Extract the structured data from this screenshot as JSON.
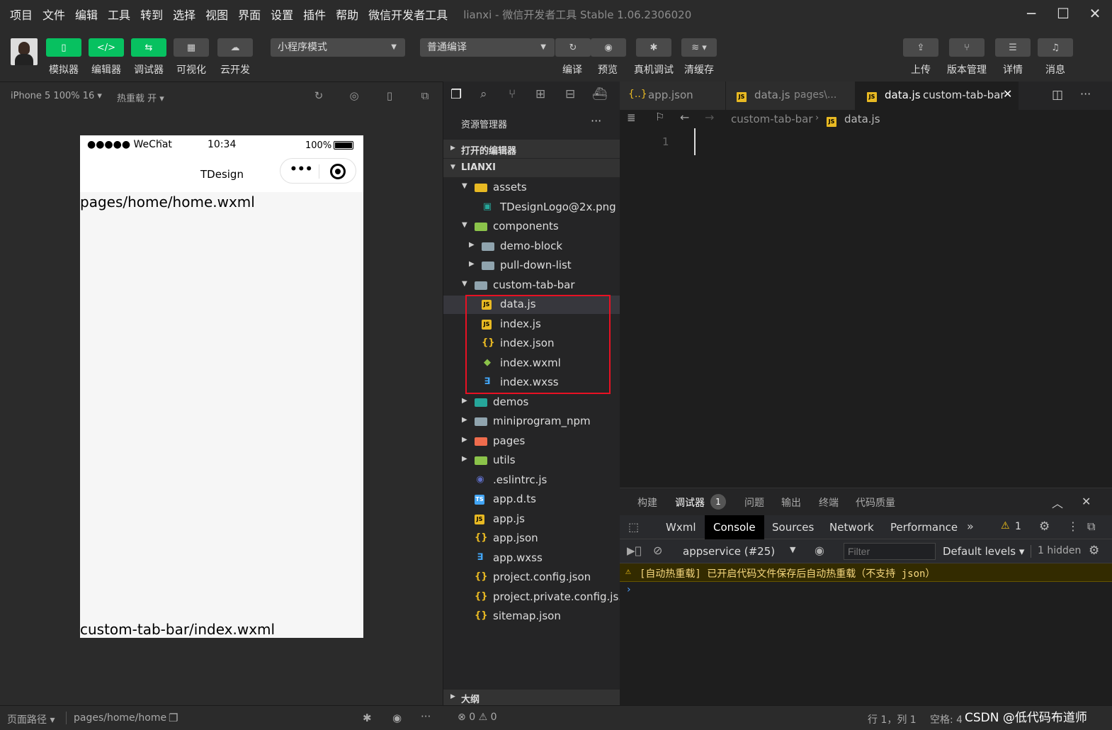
{
  "menu": [
    "项目",
    "文件",
    "编辑",
    "工具",
    "转到",
    "选择",
    "视图",
    "界面",
    "设置",
    "插件",
    "帮助",
    "微信开发者工具"
  ],
  "window_title": "lianxi - 微信开发者工具 Stable 1.06.2306020",
  "toolbar": {
    "left_buttons": [
      "模拟器",
      "编辑器",
      "调试器",
      "可视化",
      "云开发"
    ],
    "mode_select": "小程序模式",
    "compile_select": "普通编译",
    "mid_buttons": [
      "编译",
      "预览",
      "真机调试",
      "清缓存"
    ],
    "right_buttons": [
      "上传",
      "版本管理",
      "详情",
      "消息"
    ]
  },
  "simulator": {
    "device": "iPhone 5 100% 16",
    "hot_reload": "热重载 开",
    "status_carrier": "●●●●● WeChat",
    "status_time": "10:34",
    "status_battery": "100%",
    "nav_title": "TDesign",
    "page_text": "pages/home/home.wxml",
    "tabbar_text": "custom-tab-bar/index.wxml"
  },
  "explorer": {
    "title": "资源管理器",
    "open_editors": "打开的编辑器",
    "project": "LIANXI",
    "outline": "大纲",
    "tree": [
      {
        "name": "assets",
        "type": "folder-open",
        "depth": 1,
        "icon": "#e8b923"
      },
      {
        "name": "TDesignLogo@2x.png",
        "type": "image",
        "depth": 2,
        "icon": "#26a69a"
      },
      {
        "name": "components",
        "type": "folder-open",
        "depth": 1,
        "icon": "#8bc34a"
      },
      {
        "name": "demo-block",
        "type": "folder",
        "depth": 2,
        "icon": "#90a4ae"
      },
      {
        "name": "pull-down-list",
        "type": "folder",
        "depth": 2,
        "icon": "#90a4ae"
      },
      {
        "name": "custom-tab-bar",
        "type": "folder-open",
        "depth": 1,
        "icon": "#90a4ae"
      },
      {
        "name": "data.js",
        "type": "js",
        "depth": 2,
        "icon": "#e8b923"
      },
      {
        "name": "index.js",
        "type": "js",
        "depth": 2,
        "icon": "#e8b923"
      },
      {
        "name": "index.json",
        "type": "json",
        "depth": 2,
        "icon": "#e8b923"
      },
      {
        "name": "index.wxml",
        "type": "wxml",
        "depth": 2,
        "icon": "#8bc34a"
      },
      {
        "name": "index.wxss",
        "type": "wxss",
        "depth": 2,
        "icon": "#42a5f5"
      },
      {
        "name": "demos",
        "type": "folder",
        "depth": 1,
        "icon": "#26a69a"
      },
      {
        "name": "miniprogram_npm",
        "type": "folder",
        "depth": 1,
        "icon": "#90a4ae"
      },
      {
        "name": "pages",
        "type": "folder",
        "depth": 1,
        "icon": "#ef6c4d"
      },
      {
        "name": "utils",
        "type": "folder",
        "depth": 1,
        "icon": "#8bc34a"
      },
      {
        "name": ".eslintrc.js",
        "type": "eslint",
        "depth": 1,
        "icon": "#5c6bc0"
      },
      {
        "name": "app.d.ts",
        "type": "ts",
        "depth": 1,
        "icon": "#42a5f5"
      },
      {
        "name": "app.js",
        "type": "js",
        "depth": 1,
        "icon": "#e8b923"
      },
      {
        "name": "app.json",
        "type": "json",
        "depth": 1,
        "icon": "#e8b923"
      },
      {
        "name": "app.wxss",
        "type": "wxss",
        "depth": 1,
        "icon": "#42a5f5"
      },
      {
        "name": "project.config.json",
        "type": "json",
        "depth": 1,
        "icon": "#e8b923"
      },
      {
        "name": "project.private.config.js...",
        "type": "json",
        "depth": 1,
        "icon": "#e8b923"
      },
      {
        "name": "sitemap.json",
        "type": "json",
        "depth": 1,
        "icon": "#e8b923"
      }
    ]
  },
  "editor": {
    "tabs": [
      {
        "name": "app.json",
        "suffix": "",
        "type": "json"
      },
      {
        "name": "data.js",
        "suffix": "pages\\...",
        "type": "js"
      },
      {
        "name": "data.js",
        "suffix": "custom-tab-bar",
        "type": "js"
      }
    ],
    "breadcrumb_folder": "custom-tab-bar",
    "breadcrumb_file": "data.js",
    "line_number": "1"
  },
  "panel": {
    "tabs": [
      "构建",
      "调试器",
      "问题",
      "输出",
      "终端",
      "代码质量"
    ],
    "debug_badge": "1",
    "devtools_tabs": [
      "Wxml",
      "Console",
      "Sources",
      "Network",
      "Performance"
    ],
    "warn_count": "1",
    "context": "appservice (#25)",
    "filter_placeholder": "Filter",
    "levels": "Default levels",
    "hidden": "1 hidden",
    "warning_msg": "[自动热重载] 已开启代码文件保存后自动热重载（不支持 json）"
  },
  "status": {
    "page_path_label": "页面路径",
    "page_path": "pages/home/home",
    "errors": "0",
    "warnings": "0",
    "cursor": "行 1，列 1",
    "spaces": "空格: 4",
    "watermark": "CSDN @低代码布道师"
  }
}
